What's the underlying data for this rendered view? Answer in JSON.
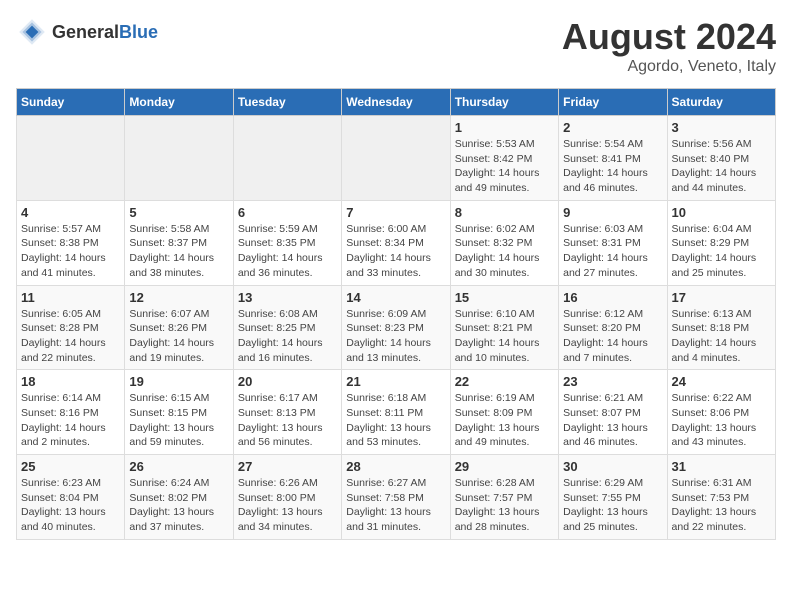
{
  "header": {
    "logo_general": "General",
    "logo_blue": "Blue",
    "title": "August 2024",
    "subtitle": "Agordo, Veneto, Italy"
  },
  "weekdays": [
    "Sunday",
    "Monday",
    "Tuesday",
    "Wednesday",
    "Thursday",
    "Friday",
    "Saturday"
  ],
  "weeks": [
    [
      {
        "day": "",
        "empty": true
      },
      {
        "day": "",
        "empty": true
      },
      {
        "day": "",
        "empty": true
      },
      {
        "day": "",
        "empty": true
      },
      {
        "day": "1",
        "sunrise": "Sunrise: 5:53 AM",
        "sunset": "Sunset: 8:42 PM",
        "daylight": "Daylight: 14 hours and 49 minutes."
      },
      {
        "day": "2",
        "sunrise": "Sunrise: 5:54 AM",
        "sunset": "Sunset: 8:41 PM",
        "daylight": "Daylight: 14 hours and 46 minutes."
      },
      {
        "day": "3",
        "sunrise": "Sunrise: 5:56 AM",
        "sunset": "Sunset: 8:40 PM",
        "daylight": "Daylight: 14 hours and 44 minutes."
      }
    ],
    [
      {
        "day": "4",
        "sunrise": "Sunrise: 5:57 AM",
        "sunset": "Sunset: 8:38 PM",
        "daylight": "Daylight: 14 hours and 41 minutes."
      },
      {
        "day": "5",
        "sunrise": "Sunrise: 5:58 AM",
        "sunset": "Sunset: 8:37 PM",
        "daylight": "Daylight: 14 hours and 38 minutes."
      },
      {
        "day": "6",
        "sunrise": "Sunrise: 5:59 AM",
        "sunset": "Sunset: 8:35 PM",
        "daylight": "Daylight: 14 hours and 36 minutes."
      },
      {
        "day": "7",
        "sunrise": "Sunrise: 6:00 AM",
        "sunset": "Sunset: 8:34 PM",
        "daylight": "Daylight: 14 hours and 33 minutes."
      },
      {
        "day": "8",
        "sunrise": "Sunrise: 6:02 AM",
        "sunset": "Sunset: 8:32 PM",
        "daylight": "Daylight: 14 hours and 30 minutes."
      },
      {
        "day": "9",
        "sunrise": "Sunrise: 6:03 AM",
        "sunset": "Sunset: 8:31 PM",
        "daylight": "Daylight: 14 hours and 27 minutes."
      },
      {
        "day": "10",
        "sunrise": "Sunrise: 6:04 AM",
        "sunset": "Sunset: 8:29 PM",
        "daylight": "Daylight: 14 hours and 25 minutes."
      }
    ],
    [
      {
        "day": "11",
        "sunrise": "Sunrise: 6:05 AM",
        "sunset": "Sunset: 8:28 PM",
        "daylight": "Daylight: 14 hours and 22 minutes."
      },
      {
        "day": "12",
        "sunrise": "Sunrise: 6:07 AM",
        "sunset": "Sunset: 8:26 PM",
        "daylight": "Daylight: 14 hours and 19 minutes."
      },
      {
        "day": "13",
        "sunrise": "Sunrise: 6:08 AM",
        "sunset": "Sunset: 8:25 PM",
        "daylight": "Daylight: 14 hours and 16 minutes."
      },
      {
        "day": "14",
        "sunrise": "Sunrise: 6:09 AM",
        "sunset": "Sunset: 8:23 PM",
        "daylight": "Daylight: 14 hours and 13 minutes."
      },
      {
        "day": "15",
        "sunrise": "Sunrise: 6:10 AM",
        "sunset": "Sunset: 8:21 PM",
        "daylight": "Daylight: 14 hours and 10 minutes."
      },
      {
        "day": "16",
        "sunrise": "Sunrise: 6:12 AM",
        "sunset": "Sunset: 8:20 PM",
        "daylight": "Daylight: 14 hours and 7 minutes."
      },
      {
        "day": "17",
        "sunrise": "Sunrise: 6:13 AM",
        "sunset": "Sunset: 8:18 PM",
        "daylight": "Daylight: 14 hours and 4 minutes."
      }
    ],
    [
      {
        "day": "18",
        "sunrise": "Sunrise: 6:14 AM",
        "sunset": "Sunset: 8:16 PM",
        "daylight": "Daylight: 14 hours and 2 minutes."
      },
      {
        "day": "19",
        "sunrise": "Sunrise: 6:15 AM",
        "sunset": "Sunset: 8:15 PM",
        "daylight": "Daylight: 13 hours and 59 minutes."
      },
      {
        "day": "20",
        "sunrise": "Sunrise: 6:17 AM",
        "sunset": "Sunset: 8:13 PM",
        "daylight": "Daylight: 13 hours and 56 minutes."
      },
      {
        "day": "21",
        "sunrise": "Sunrise: 6:18 AM",
        "sunset": "Sunset: 8:11 PM",
        "daylight": "Daylight: 13 hours and 53 minutes."
      },
      {
        "day": "22",
        "sunrise": "Sunrise: 6:19 AM",
        "sunset": "Sunset: 8:09 PM",
        "daylight": "Daylight: 13 hours and 49 minutes."
      },
      {
        "day": "23",
        "sunrise": "Sunrise: 6:21 AM",
        "sunset": "Sunset: 8:07 PM",
        "daylight": "Daylight: 13 hours and 46 minutes."
      },
      {
        "day": "24",
        "sunrise": "Sunrise: 6:22 AM",
        "sunset": "Sunset: 8:06 PM",
        "daylight": "Daylight: 13 hours and 43 minutes."
      }
    ],
    [
      {
        "day": "25",
        "sunrise": "Sunrise: 6:23 AM",
        "sunset": "Sunset: 8:04 PM",
        "daylight": "Daylight: 13 hours and 40 minutes."
      },
      {
        "day": "26",
        "sunrise": "Sunrise: 6:24 AM",
        "sunset": "Sunset: 8:02 PM",
        "daylight": "Daylight: 13 hours and 37 minutes."
      },
      {
        "day": "27",
        "sunrise": "Sunrise: 6:26 AM",
        "sunset": "Sunset: 8:00 PM",
        "daylight": "Daylight: 13 hours and 34 minutes."
      },
      {
        "day": "28",
        "sunrise": "Sunrise: 6:27 AM",
        "sunset": "Sunset: 7:58 PM",
        "daylight": "Daylight: 13 hours and 31 minutes."
      },
      {
        "day": "29",
        "sunrise": "Sunrise: 6:28 AM",
        "sunset": "Sunset: 7:57 PM",
        "daylight": "Daylight: 13 hours and 28 minutes."
      },
      {
        "day": "30",
        "sunrise": "Sunrise: 6:29 AM",
        "sunset": "Sunset: 7:55 PM",
        "daylight": "Daylight: 13 hours and 25 minutes."
      },
      {
        "day": "31",
        "sunrise": "Sunrise: 6:31 AM",
        "sunset": "Sunset: 7:53 PM",
        "daylight": "Daylight: 13 hours and 22 minutes."
      }
    ]
  ]
}
